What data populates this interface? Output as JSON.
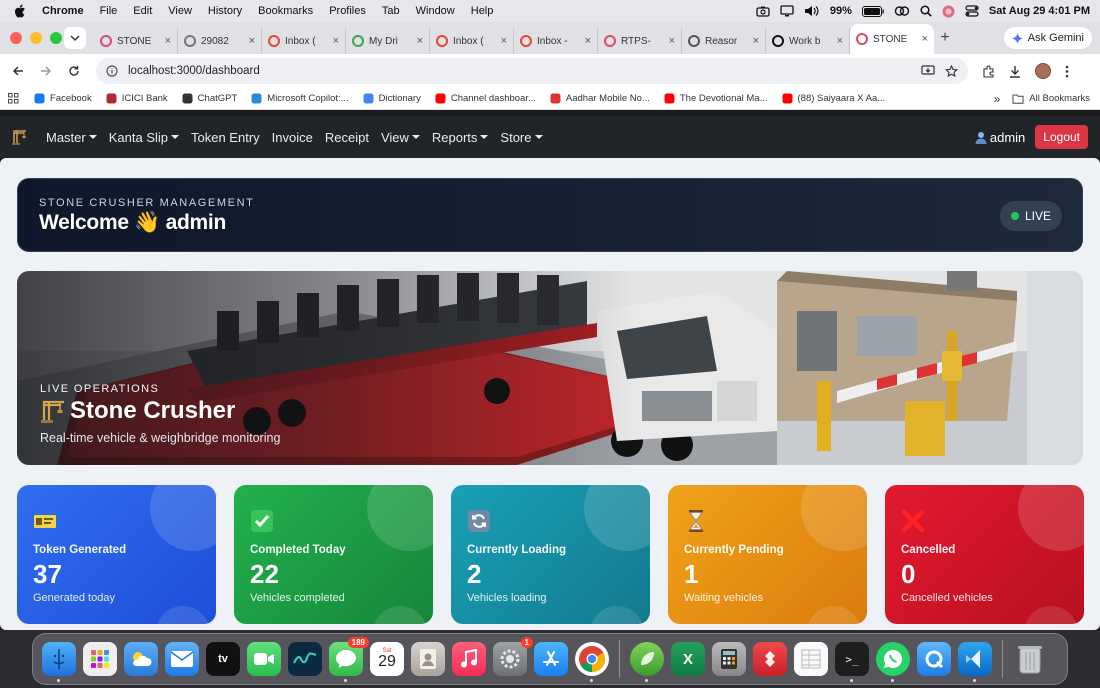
{
  "menubar": {
    "app": "Chrome",
    "items": [
      "File",
      "Edit",
      "View",
      "History",
      "Bookmarks",
      "Profiles",
      "Tab",
      "Window",
      "Help"
    ],
    "battery": "99%",
    "datetime": "Sat Aug 29  4:01 PM"
  },
  "tabs": [
    {
      "title": "STONE",
      "fav": "#d94b6a",
      "active": false
    },
    {
      "title": "29082",
      "fav": "#777",
      "active": false
    },
    {
      "title": "Inbox (",
      "fav": "#ea4335",
      "active": false
    },
    {
      "title": "My Dri",
      "fav": "#34a853",
      "active": false
    },
    {
      "title": "Inbox (",
      "fav": "#ea4335",
      "active": false
    },
    {
      "title": "Inbox -",
      "fav": "#ea4335",
      "active": false
    },
    {
      "title": "RTPS-",
      "fav": "#d94b6a",
      "active": false
    },
    {
      "title": "Reasor",
      "fav": "#555",
      "active": false
    },
    {
      "title": "Work b",
      "fav": "#111",
      "active": false
    },
    {
      "title": "STONE",
      "fav": "#d94b6a",
      "active": true
    }
  ],
  "gemini_label": "Ask Gemini",
  "address": {
    "url": "localhost:3000/dashboard"
  },
  "bookmarks": [
    {
      "label": "Facebook",
      "color": "#1877f2"
    },
    {
      "label": "ICICI Bank",
      "color": "#b02a30"
    },
    {
      "label": "ChatGPT",
      "color": "#333"
    },
    {
      "label": "Microsoft Copilot:...",
      "color": "#2b88d8"
    },
    {
      "label": "Dictionary",
      "color": "#4285f4"
    },
    {
      "label": "Channel dashboar...",
      "color": "#ff0000"
    },
    {
      "label": "Aadhar Mobile No...",
      "color": "#d33"
    },
    {
      "label": "The Devotional Ma...",
      "color": "#ff0000"
    },
    {
      "label": "(88) Saiyaara X Aa...",
      "color": "#ff0000"
    }
  ],
  "bookmarks_more": "»",
  "all_bookmarks": "All Bookmarks",
  "nav": {
    "items": [
      {
        "label": "Master",
        "dropdown": true
      },
      {
        "label": "Kanta Slip",
        "dropdown": true
      },
      {
        "label": "Token Entry",
        "dropdown": false
      },
      {
        "label": "Invoice",
        "dropdown": false
      },
      {
        "label": "Receipt",
        "dropdown": false
      },
      {
        "label": "View",
        "dropdown": true
      },
      {
        "label": "Reports",
        "dropdown": true
      },
      {
        "label": "Store",
        "dropdown": true
      }
    ],
    "user": "admin",
    "logout": "Logout"
  },
  "welcome": {
    "kicker": "STONE CRUSHER MANAGEMENT",
    "title": "Welcome 👋 admin",
    "live": "LIVE"
  },
  "hero": {
    "kicker": "LIVE OPERATIONS",
    "title": "Stone Crusher",
    "subtitle": "Real-time vehicle & weighbridge monitoring"
  },
  "cards": [
    {
      "label": "Token Generated",
      "value": "37",
      "sub": "Generated today",
      "icon": "id-card-icon",
      "from": "#2f6ef0",
      "to": "#1d4ed8"
    },
    {
      "label": "Completed Today",
      "value": "22",
      "sub": "Vehicles completed",
      "icon": "check-box-icon",
      "from": "#22b14c",
      "to": "#15863a"
    },
    {
      "label": "Currently Loading",
      "value": "2",
      "sub": "Vehicles loading",
      "icon": "refresh-icon",
      "from": "#1aa0b5",
      "to": "#117a8e"
    },
    {
      "label": "Currently Pending",
      "value": "1",
      "sub": "Waiting vehicles",
      "icon": "hourglass-icon",
      "from": "#f0a21a",
      "to": "#dc7b0c"
    },
    {
      "label": "Cancelled",
      "value": "0",
      "sub": "Cancelled vehicles",
      "icon": "cross-icon",
      "from": "#e3192f",
      "to": "#b8101f"
    }
  ],
  "dock": {
    "messages_badge": "189",
    "settings_badge": "1",
    "calendar_day": "29",
    "calendar_month": "Sat"
  }
}
